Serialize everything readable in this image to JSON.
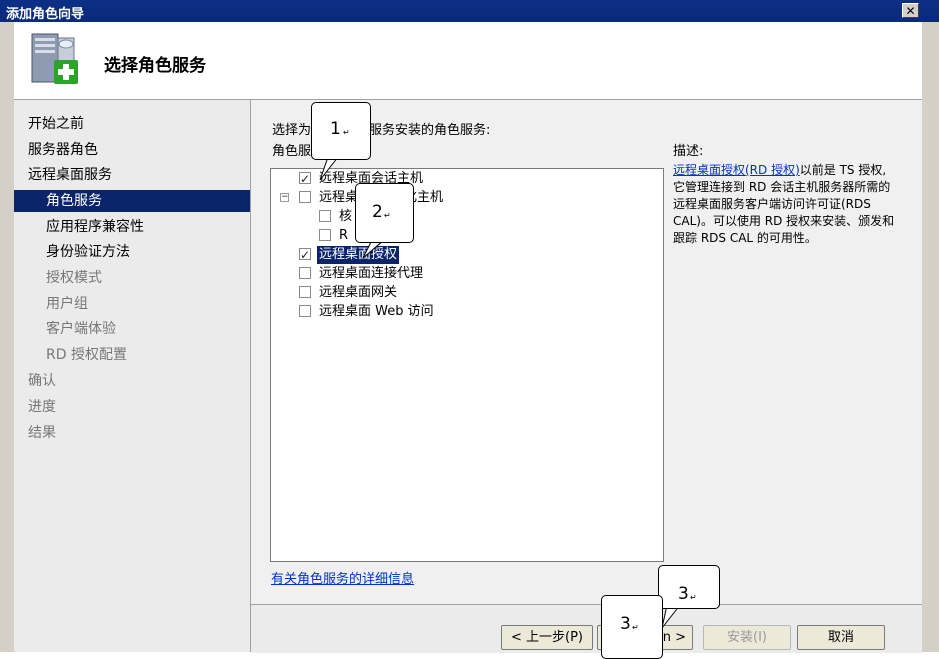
{
  "window": {
    "title": "添加角色向导",
    "close_label": "✕"
  },
  "header": {
    "title": "选择角色服务",
    "icon": "server-role-add-icon"
  },
  "nav": {
    "items": [
      {
        "label": "开始之前",
        "level": 1,
        "state": "normal"
      },
      {
        "label": "服务器角色",
        "level": 1,
        "state": "normal"
      },
      {
        "label": "远程桌面服务",
        "level": 1,
        "state": "normal"
      },
      {
        "label": "角色服务",
        "level": 2,
        "state": "selected"
      },
      {
        "label": "应用程序兼容性",
        "level": 2,
        "state": "normal"
      },
      {
        "label": "身份验证方法",
        "level": 2,
        "state": "normal"
      },
      {
        "label": "授权模式",
        "level": 2,
        "state": "dim"
      },
      {
        "label": "用户组",
        "level": 2,
        "state": "dim"
      },
      {
        "label": "客户端体验",
        "level": 2,
        "state": "dim"
      },
      {
        "label": "RD 授权配置",
        "level": 2,
        "state": "dim"
      },
      {
        "label": "确认",
        "level": 1,
        "state": "dim"
      },
      {
        "label": "进度",
        "level": 1,
        "state": "dim"
      },
      {
        "label": "结果",
        "level": 1,
        "state": "dim"
      }
    ]
  },
  "main": {
    "prompt": "选择为",
    "prompt_tail": "服务安装的角色服务:",
    "list_label": "角色服",
    "services": [
      {
        "label": "远程桌面会话主机",
        "checked": true,
        "selected": false
      },
      {
        "label": "远程桌",
        "label_tail": "化主机",
        "checked": false,
        "selected": false
      },
      {
        "label": "核",
        "checked": false,
        "selected": false
      },
      {
        "label": "R",
        "checked": false,
        "selected": false
      },
      {
        "label": "远程桌面授权",
        "checked": true,
        "selected": true
      },
      {
        "label": "远程桌面连接代理",
        "checked": false,
        "selected": false
      },
      {
        "label": "远程桌面网关",
        "checked": false,
        "selected": false
      },
      {
        "label": "远程桌面 Web 访问",
        "checked": false,
        "selected": false
      }
    ],
    "description_label": "描述:",
    "description_link": "远程桌面授权(RD 授权)",
    "description_text": "以前是 TS 授权,它管理连接到 RD 会话主机服务器所需的远程桌面服务客户端访问许可证(RDS CAL)。可以使用 RD 授权来安装、颁发和跟踪 RDS CAL 的可用性。",
    "more_info_link": "有关角色服务的详细信息"
  },
  "footer": {
    "back": "< 上一步(P)",
    "next_tail": "n >",
    "install": "安装(I)",
    "cancel": "取消"
  },
  "callouts": [
    {
      "num": "1",
      "mark": "↵"
    },
    {
      "num": "2",
      "mark": "↵"
    },
    {
      "num": "3",
      "mark": "↵"
    },
    {
      "num": "3",
      "mark": "↵"
    }
  ],
  "colors": {
    "titlebar": "#0a2a7a",
    "selection": "#0a246a",
    "link": "#0033cc"
  }
}
